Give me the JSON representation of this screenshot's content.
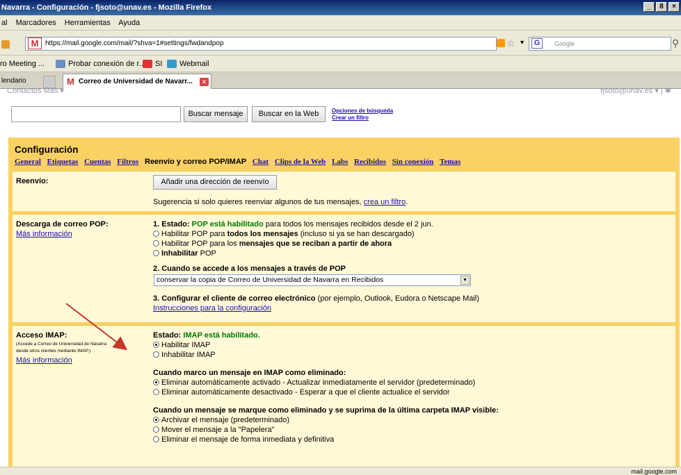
{
  "window": {
    "title": "Navarra - Configuración - fjsoto@unav.es - Mozilla Firefox",
    "buttons": [
      "_",
      "8",
      "×"
    ]
  },
  "menu": {
    "items": [
      "al",
      "Marcadores",
      "Herramientas",
      "Ayuda"
    ]
  },
  "nav": {
    "url": "https://mail.google.com/mail/?shva=1#settings/fwdandpop",
    "search_placeholder": "Google",
    "search_engine": "G"
  },
  "bookmarks": [
    "ro Meeting ...",
    "Probar conexión de r...",
    "SI",
    "Webmail"
  ],
  "tabs": {
    "first": "lendario",
    "active": "Correo de Universidad de Navarr...",
    "active_icon": "M"
  },
  "gbar": {
    "left": "Contactos  Más ▾",
    "right": "fjsoto@unav.es ▾  |  ✱"
  },
  "search": {
    "btn_search": "Buscar mensaje",
    "btn_web": "Buscar en la Web",
    "link_options": "Opciones de búsqueda",
    "link_filter": "Crear un filtro"
  },
  "settings": {
    "title": "Configuración",
    "tabs": [
      "General",
      "Etiquetas",
      "Cuentas",
      "Filtros",
      "Reenvío y correo POP/IMAP",
      "Chat",
      "Clips de la Web",
      "Labs",
      "Recibidos",
      "Sin conexión",
      "Temas"
    ],
    "forwarding": {
      "label": "Reenvío:",
      "button": "Añadir una dirección de reenvío",
      "hint_prefix": "Sugerencia  si solo quieres reenviar algunos de tus mensajes, ",
      "hint_link": "crea un filtro",
      "hint_suffix": "."
    },
    "pop": {
      "label": "Descarga de correo POP:",
      "more": "Más información",
      "status_prefix": "1. Estado: ",
      "status_value": "POP está habilitado",
      "status_suffix": " para todos los mensajes recibidos desde el 2 jun.",
      "opt1_a": "Habilitar POP para ",
      "opt1_b": "todos los mensajes",
      "opt1_c": " (incluso si ya se han descargado)",
      "opt2_a": "Habilitar POP para los ",
      "opt2_b": "mensajes que se reciban a partir de ahora",
      "opt3_a": "Inhabilitar",
      "opt3_b": " POP",
      "access_title": "2. Cuando se accede a los mensajes a través de POP",
      "access_value": "conservar la copia de Correo de Universidad de Navarra en Recibidos",
      "config_title": "3. Configurar el cliente de correo electrónico",
      "config_rest": " (por ejemplo, Outlook, Eudora o Netscape Mail)",
      "config_link": "Instrucciones para la configuración"
    },
    "imap": {
      "label": "Acceso IMAP:",
      "sub1": "(Accede a Correo de Universidad de Navarra",
      "sub2": "desde otros clientes mediante IMAP.)",
      "more": "Más información",
      "status_prefix": "Estado: ",
      "status_value": "IMAP está habilitado.",
      "enable": "Habilitar IMAP",
      "disable": "Inhabilitar IMAP",
      "delete_title": "Cuando marco un mensaje en IMAP como eliminado:",
      "delete_opt1": "Eliminar automáticamente activado - Actualizar inmediatamente el servidor (predeterminado)",
      "delete_opt2": "Eliminar automáticamente desactivado - Esperar a que el cliente actualice el servidor",
      "expunge_title": "Cuando un mensaje se marque como eliminado y se suprima de la última carpeta IMAP visible:",
      "expunge_opt1": "Archivar el mensaje (predeterminado)",
      "expunge_opt2": "Mover el mensaje a la \"Papelera\"",
      "expunge_opt3": "Eliminar el mensaje de forma inmediata y definitiva"
    }
  },
  "status": {
    "right": "mail.google.com"
  },
  "colors": {
    "settings_bg": "#fad163",
    "panel_bg": "#fff9d7",
    "link": "#1a0dab",
    "arrow": "#c0392b"
  }
}
